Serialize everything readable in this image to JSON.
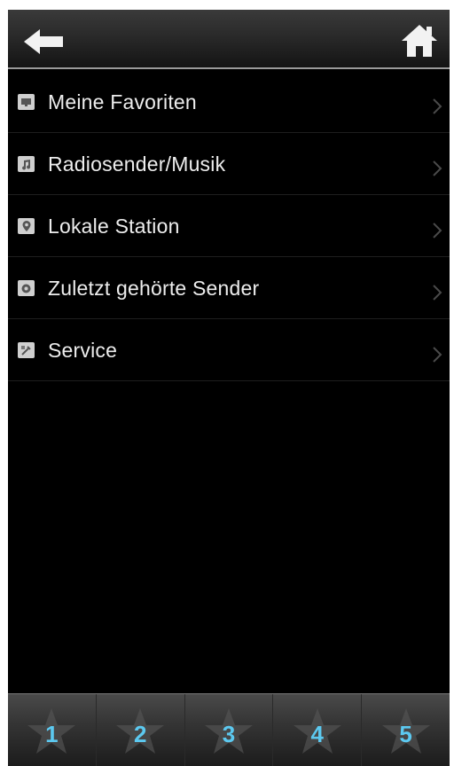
{
  "header": {
    "back_icon": "arrow-left-icon",
    "home_icon": "home-icon"
  },
  "menu": {
    "items": [
      {
        "label": "Meine Favoriten",
        "icon": "favorites-icon"
      },
      {
        "label": "Radiosender/Musik",
        "icon": "music-note-icon"
      },
      {
        "label": "Lokale Station",
        "icon": "location-pin-icon"
      },
      {
        "label": "Zuletzt gehörte Sender",
        "icon": "history-icon"
      },
      {
        "label": "Service",
        "icon": "service-icon"
      }
    ],
    "chevron_icon": "chevron-right-icon"
  },
  "presets": {
    "icon": "star-icon",
    "items": [
      {
        "label": "1"
      },
      {
        "label": "2"
      },
      {
        "label": "3"
      },
      {
        "label": "4"
      },
      {
        "label": "5"
      }
    ]
  },
  "colors": {
    "background": "#000000",
    "text": "#ededed",
    "preset_number": "#5cc9f0"
  }
}
